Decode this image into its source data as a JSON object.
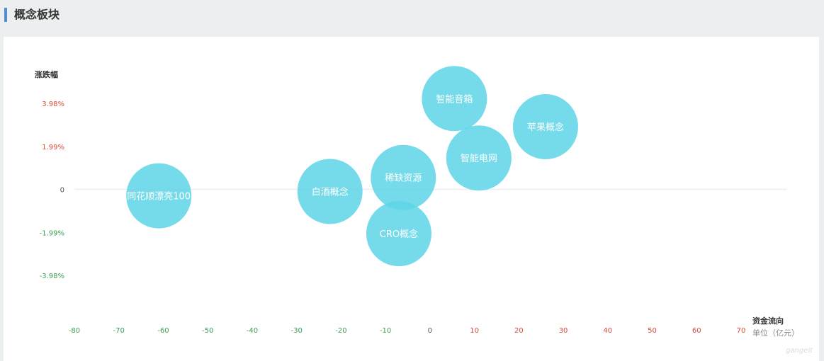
{
  "header": {
    "title": "概念板块"
  },
  "colors": {
    "positive": "#d84b3b",
    "negative": "#3e9e54",
    "neutral": "#555555",
    "bubble": "#5dd5e6",
    "zero_line": "#eef1f3"
  },
  "chart_data": {
    "type": "scatter",
    "ylabel": "涨跌幅",
    "xlabel": "资金流向",
    "x_unit": "单位（亿元）",
    "xlim": [
      -80,
      75
    ],
    "ylim": [
      -5.8,
      7.2
    ],
    "x_ticks": [
      -80,
      -70,
      -60,
      -50,
      -40,
      -30,
      -20,
      -10,
      0,
      10,
      20,
      30,
      40,
      50,
      60,
      70
    ],
    "y_ticks": [
      {
        "value": 3.98,
        "label": "3.98%"
      },
      {
        "value": 1.99,
        "label": "1.99%"
      },
      {
        "value": 0,
        "label": "0"
      },
      {
        "value": -1.99,
        "label": "-1.99%"
      },
      {
        "value": -3.98,
        "label": "-3.98%"
      }
    ],
    "points": [
      {
        "name": "同花顺漂亮100",
        "x": -61,
        "y": -0.3
      },
      {
        "name": "白酒概念",
        "x": -22.5,
        "y": -0.1
      },
      {
        "name": "稀缺资源",
        "x": -6,
        "y": 0.55
      },
      {
        "name": "CRO概念",
        "x": -7,
        "y": -2.05
      },
      {
        "name": "智能音箱",
        "x": 5.5,
        "y": 4.2
      },
      {
        "name": "智能电网",
        "x": 11,
        "y": 1.45
      },
      {
        "name": "苹果概念",
        "x": 26,
        "y": 2.9
      }
    ]
  },
  "watermark": "gangeit"
}
